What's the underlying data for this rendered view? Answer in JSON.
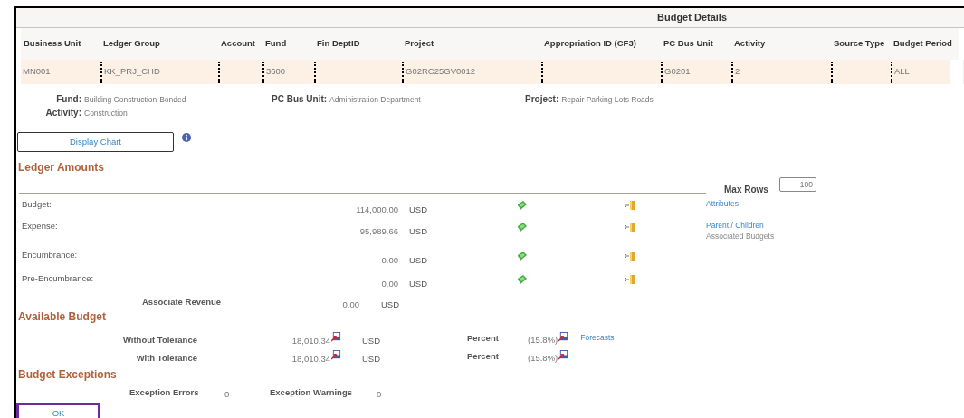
{
  "window": {
    "title": "Budget Details"
  },
  "key_grid": {
    "columns": [
      {
        "label": "Business Unit",
        "value": "MN001"
      },
      {
        "label": "Ledger Group",
        "value": "KK_PRJ_CHD"
      },
      {
        "label": "Account"
      },
      {
        "label": "Fund",
        "value": "3600"
      },
      {
        "label": "Fin DeptID"
      },
      {
        "label": "Project",
        "value": "G02RC25GV0012"
      },
      {
        "label": "Appropriation ID (CF3)"
      },
      {
        "label": "PC Bus Unit",
        "value": "G0201"
      },
      {
        "label": "Activity",
        "value": "2"
      },
      {
        "label": "Source Type"
      },
      {
        "label": "Budget Period",
        "value": "ALL"
      }
    ]
  },
  "descriptions": [
    [
      {
        "label": "Fund:",
        "value": "Building Construction-Bonded"
      },
      {
        "label": "Activity:",
        "value": "Construction"
      }
    ],
    [
      {
        "label": "PC Bus Unit:",
        "value": "Administration Department"
      }
    ],
    [
      {
        "label": "Project:",
        "value": "Repair Parking Lots Roads"
      }
    ]
  ],
  "display_chart_button": "Display Chart",
  "ledger_amounts": {
    "heading": "Ledger Amounts",
    "max_rows": {
      "label": "Max Rows",
      "value": "100"
    },
    "rows": [
      {
        "label": "Budget:",
        "amount": "114,000.00",
        "currency": "USD",
        "links": [
          {
            "kind": "link",
            "text": "Attributes"
          }
        ]
      },
      {
        "label": "Expense:",
        "amount": "95,989.66",
        "currency": "USD",
        "links": [
          {
            "kind": "link",
            "text": "Parent / Children"
          },
          {
            "kind": "note",
            "text": "Associated Budgets"
          }
        ]
      },
      {
        "label": "Encumbrance:",
        "amount": "0.00",
        "currency": "USD"
      },
      {
        "label": "Pre-Encumbrance:",
        "amount": "0.00",
        "currency": "USD"
      }
    ]
  },
  "associate_revenue": {
    "label": "Associate Revenue",
    "amount": "0.00",
    "currency": "USD"
  },
  "available_budget": {
    "heading": "Available Budget",
    "rows": [
      {
        "label": "Without Tolerance",
        "amount": "18,010.34",
        "currency": "USD",
        "percent_label": "Percent",
        "percent": "(15.8%)",
        "link": "Forecasts"
      },
      {
        "label": "With Tolerance",
        "amount": "18,010.34",
        "currency": "USD",
        "percent_label": "Percent",
        "percent": "(15.8%)"
      }
    ]
  },
  "budget_exceptions": {
    "heading": "Budget Exceptions",
    "errors_label": "Exception Errors",
    "errors": "0",
    "warnings_label": "Exception Warnings",
    "warnings": "0"
  },
  "ok_button": "OK"
}
